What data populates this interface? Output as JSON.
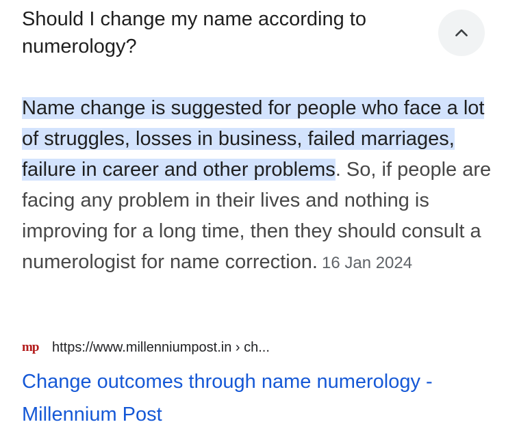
{
  "question": "Should I change my name according to numerology?",
  "collapse_icon": "chevron-up-icon",
  "answer": {
    "highlighted": "Name change is suggested for people who face a lot of struggles, losses in business, failed marriages, failure in career and other problems",
    "rest": ". So, if people are facing any problem in their lives and nothing is improving for a long time, then they should consult a numerologist for name correction.",
    "date": "16 Jan 2024"
  },
  "source": {
    "favicon_text": "mp",
    "url": "https://www.millenniumpost.in › ch..."
  },
  "result": {
    "title": "Change outcomes through name numerology - Millennium Post"
  },
  "colors": {
    "highlight": "#d3e3fd",
    "link": "#1558d6",
    "favicon": "#b31b1b"
  }
}
